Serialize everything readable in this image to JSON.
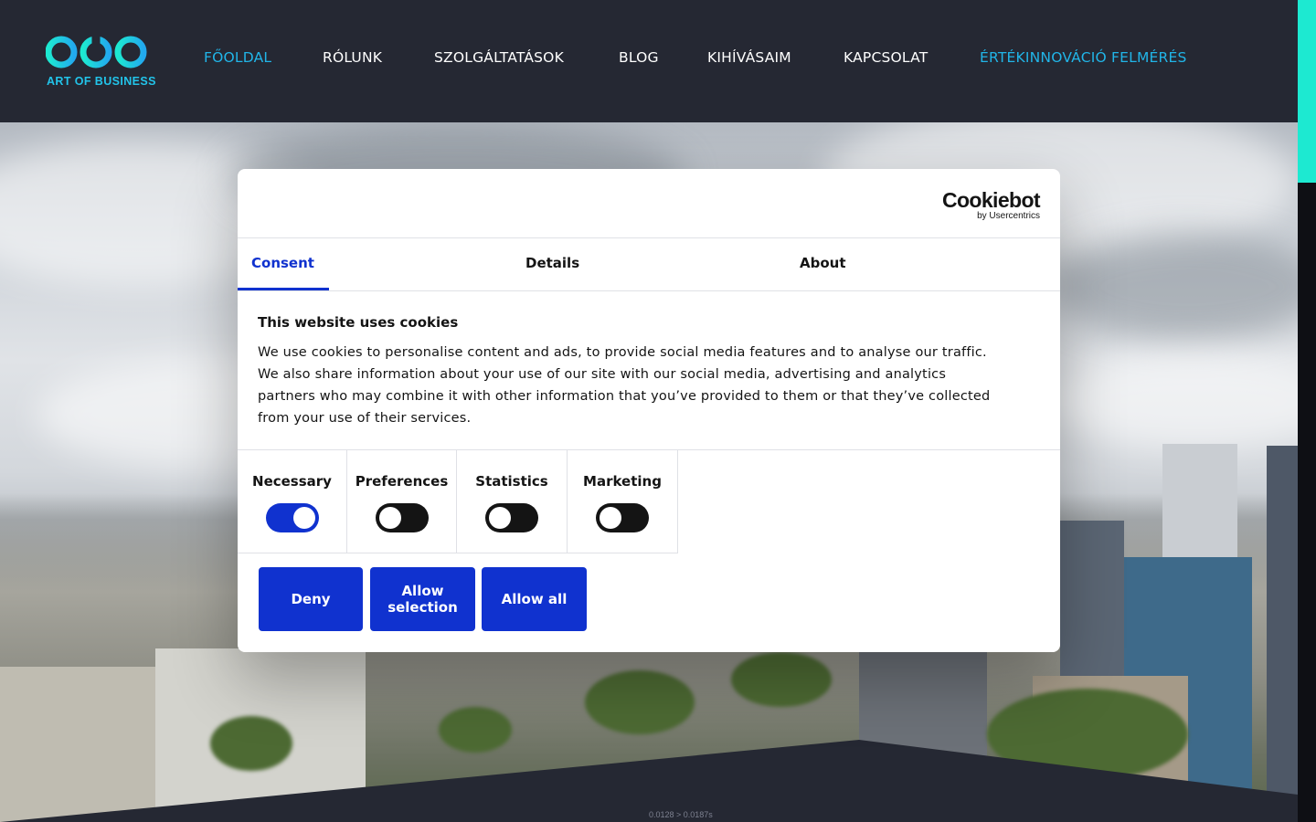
{
  "header": {
    "logo_text": "ART OF BUSINESS",
    "nav": [
      {
        "label": "FŐOLDAL",
        "active": true
      },
      {
        "label": "RÓLUNK",
        "active": false
      },
      {
        "label": "SZOLGÁLTATÁSOK",
        "active": false
      },
      {
        "label": "BLOG",
        "active": false
      },
      {
        "label": "KIHÍVÁSAIM",
        "active": false
      },
      {
        "label": "KAPCSOLAT",
        "active": false
      },
      {
        "label": "ÉRTÉKINNOVÁCIÓ FELMÉRÉS",
        "active": true
      }
    ]
  },
  "hero": {
    "timing_text": "0.0128 > 0.0187s"
  },
  "cookie_dialog": {
    "brand": "Cookiebot",
    "brand_sub": "by Usercentrics",
    "tabs": [
      {
        "label": "Consent",
        "active": true
      },
      {
        "label": "Details",
        "active": false
      },
      {
        "label": "About",
        "active": false
      }
    ],
    "heading": "This website uses cookies",
    "body": "We use cookies to personalise content and ads, to provide social media features and to analyse our traffic. We also share information about your use of our site with our social media, advertising and analytics partners who may combine it with other information that you’ve provided to them or that they’ve collected from your use of their services.",
    "levels": [
      {
        "label": "Necessary",
        "enabled": true
      },
      {
        "label": "Preferences",
        "enabled": false
      },
      {
        "label": "Statistics",
        "enabled": false
      },
      {
        "label": "Marketing",
        "enabled": false
      }
    ],
    "buttons": {
      "deny": "Deny",
      "allow_selection_1": "Allow",
      "allow_selection_2": "selection",
      "allow_all": "Allow all"
    }
  },
  "colors": {
    "header_bg": "#252833",
    "accent_cyan": "#21b5e8",
    "scroll_accent": "#1de9d1",
    "cookiebot_blue": "#1032cf"
  }
}
